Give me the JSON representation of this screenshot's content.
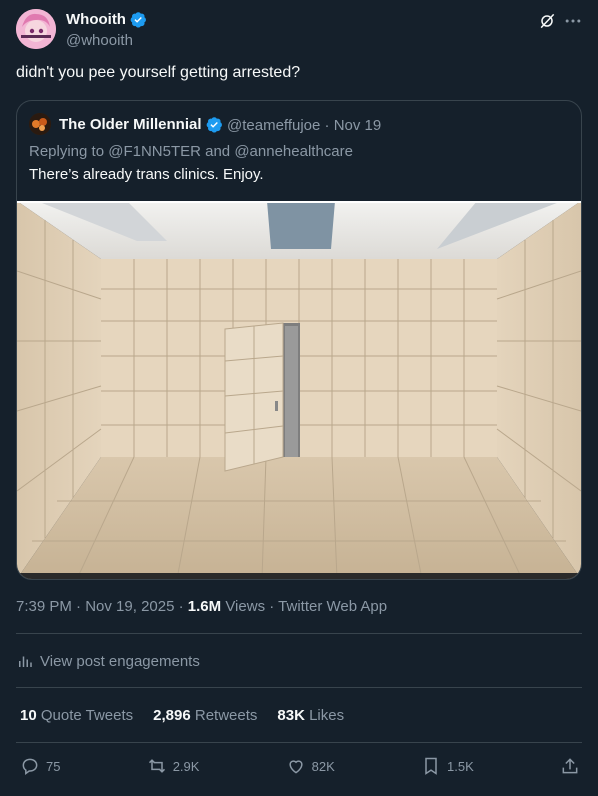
{
  "tweet": {
    "author_name": "Whooith",
    "author_handle": "@whooith",
    "text": "didn't you pee yourself getting arrested?",
    "time": "7:39 PM",
    "date": "Nov 19, 2025",
    "views_count": "1.6M",
    "views_label": "Views",
    "source": "Twitter Web App"
  },
  "quote": {
    "author_name": "The Older Millennial",
    "author_handle": "@teameffujoe",
    "date": "Nov 19",
    "replying_prefix": "Replying to",
    "replying_users": "@F1NN5TER and @annehealthcare",
    "text": "There’s already trans clinics. Enjoy."
  },
  "engagements_link": "View post engagements",
  "stats": {
    "quotes_count": "10",
    "quotes_label": "Quote Tweets",
    "retweets_count": "2,896",
    "retweets_label": "Retweets",
    "likes_count": "83K",
    "likes_label": "Likes"
  },
  "actions": {
    "reply": "75",
    "retweet": "2.9K",
    "like": "82K",
    "bookmark": "1.5K"
  },
  "colors": {
    "background": "#15202b",
    "text": "#f7f9f9",
    "secondary": "#8b98a5",
    "border": "#38444d",
    "verified": "#1d9bf0"
  },
  "icons": [
    "verified-badge-icon",
    "grok-icon",
    "more-icon",
    "engagement-chart-icon",
    "reply-icon",
    "retweet-icon",
    "like-icon",
    "bookmark-icon",
    "share-icon"
  ]
}
